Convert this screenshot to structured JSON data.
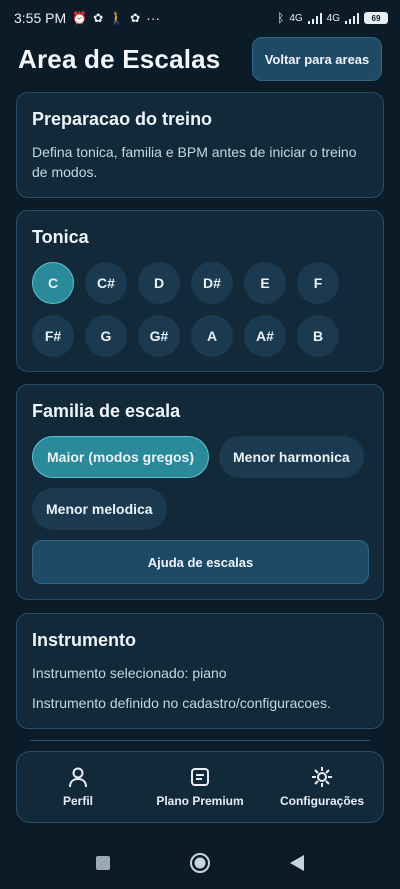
{
  "status_bar": {
    "time": "3:55 PM",
    "dots": "···",
    "net1": "4G",
    "net2": "4G",
    "battery": "69"
  },
  "header": {
    "title": "Area de Escalas",
    "back_label": "Voltar para areas"
  },
  "prep_card": {
    "title": "Preparacao do treino",
    "text": "Defina tonica, familia e BPM antes de iniciar o treino de modos."
  },
  "tonic_card": {
    "title": "Tonica",
    "notes": [
      "C",
      "C#",
      "D",
      "D#",
      "E",
      "F",
      "F#",
      "G",
      "G#",
      "A",
      "A#",
      "B"
    ],
    "selected": "C"
  },
  "family_card": {
    "title": "Familia de escala",
    "options": [
      "Maior (modos gregos)",
      "Menor harmonica",
      "Menor melodica"
    ],
    "selected": "Maior (modos gregos)",
    "help_label": "Ajuda de escalas"
  },
  "instrument_card": {
    "title": "Instrumento",
    "selected_text": "Instrumento selecionado: piano",
    "defined_text": "Instrumento definido no cadastro/configuracoes."
  },
  "bottom_nav": {
    "items": [
      {
        "label": "Perfil",
        "icon": "person-icon"
      },
      {
        "label": "Plano Premium",
        "icon": "card-icon"
      },
      {
        "label": "Configurações",
        "icon": "gear-icon"
      }
    ]
  },
  "colors": {
    "background": "#0b1b28",
    "card": "#12293a",
    "accent": "#2a8a9a",
    "button": "#1f4a66"
  }
}
